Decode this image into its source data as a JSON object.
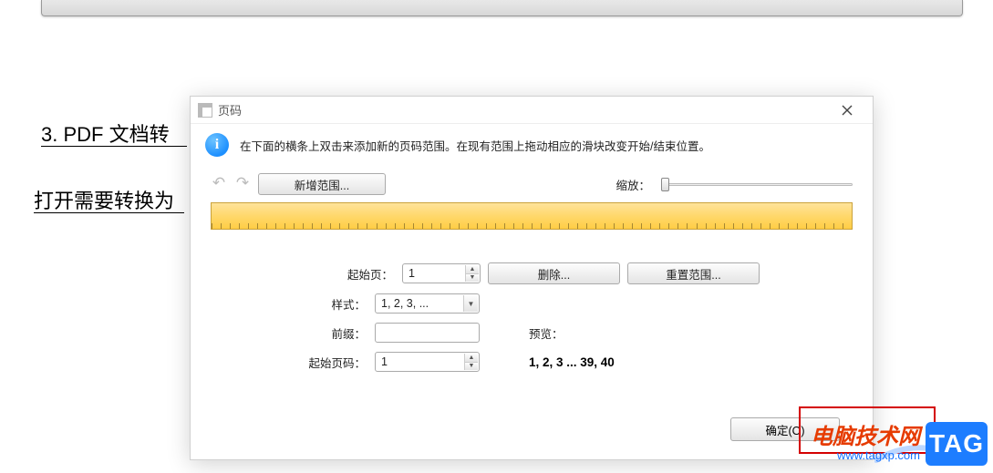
{
  "bg": {
    "line1": "3.  PDF 文档转",
    "line2": "打开需要转换为"
  },
  "dialog": {
    "title": "页码",
    "info": "在下面的横条上双击来添加新的页码范围。在现有范围上拖动相应的滑块改变开始/结束位置。",
    "new_range": "新增范围...",
    "zoom_label": "缩放：",
    "start_page_label": "起始页：",
    "start_page_value": "1",
    "delete": "删除...",
    "reset": "重置范围...",
    "style_label": "样式：",
    "style_value": "1, 2, 3, ...",
    "prefix_label": "前缀：",
    "prefix_value": "",
    "start_num_label": "起始页码：",
    "start_num_value": "1",
    "preview_label": "预览：",
    "preview_value": "1, 2, 3 ... 39, 40",
    "ok": "确定(O)"
  },
  "watermark": {
    "cn": "电脑技术网",
    "url": "www.tagxp.com",
    "tag": "TAG"
  }
}
